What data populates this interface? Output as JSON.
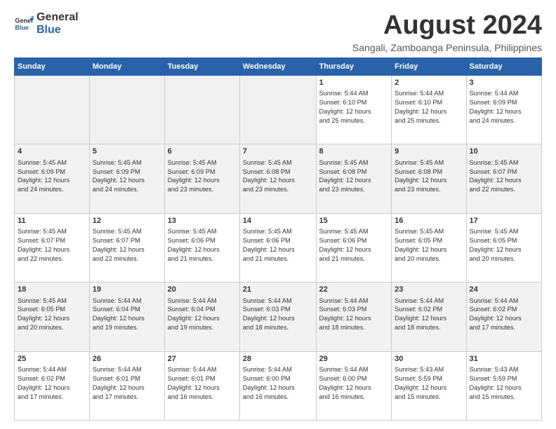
{
  "logo": {
    "line1": "General",
    "line2": "Blue"
  },
  "title": "August 2024",
  "subtitle": "Sangali, Zamboanga Peninsula, Philippines",
  "calendar": {
    "headers": [
      "Sunday",
      "Monday",
      "Tuesday",
      "Wednesday",
      "Thursday",
      "Friday",
      "Saturday"
    ],
    "weeks": [
      [
        {
          "day": "",
          "info": ""
        },
        {
          "day": "",
          "info": ""
        },
        {
          "day": "",
          "info": ""
        },
        {
          "day": "",
          "info": ""
        },
        {
          "day": "1",
          "info": "Sunrise: 5:44 AM\nSunset: 6:10 PM\nDaylight: 12 hours\nand 25 minutes."
        },
        {
          "day": "2",
          "info": "Sunrise: 5:44 AM\nSunset: 6:10 PM\nDaylight: 12 hours\nand 25 minutes."
        },
        {
          "day": "3",
          "info": "Sunrise: 5:44 AM\nSunset: 6:09 PM\nDaylight: 12 hours\nand 24 minutes."
        }
      ],
      [
        {
          "day": "4",
          "info": "Sunrise: 5:45 AM\nSunset: 6:09 PM\nDaylight: 12 hours\nand 24 minutes."
        },
        {
          "day": "5",
          "info": "Sunrise: 5:45 AM\nSunset: 6:09 PM\nDaylight: 12 hours\nand 24 minutes."
        },
        {
          "day": "6",
          "info": "Sunrise: 5:45 AM\nSunset: 6:09 PM\nDaylight: 12 hours\nand 23 minutes."
        },
        {
          "day": "7",
          "info": "Sunrise: 5:45 AM\nSunset: 6:08 PM\nDaylight: 12 hours\nand 23 minutes."
        },
        {
          "day": "8",
          "info": "Sunrise: 5:45 AM\nSunset: 6:08 PM\nDaylight: 12 hours\nand 23 minutes."
        },
        {
          "day": "9",
          "info": "Sunrise: 5:45 AM\nSunset: 6:08 PM\nDaylight: 12 hours\nand 23 minutes."
        },
        {
          "day": "10",
          "info": "Sunrise: 5:45 AM\nSunset: 6:07 PM\nDaylight: 12 hours\nand 22 minutes."
        }
      ],
      [
        {
          "day": "11",
          "info": "Sunrise: 5:45 AM\nSunset: 6:07 PM\nDaylight: 12 hours\nand 22 minutes."
        },
        {
          "day": "12",
          "info": "Sunrise: 5:45 AM\nSunset: 6:07 PM\nDaylight: 12 hours\nand 22 minutes."
        },
        {
          "day": "13",
          "info": "Sunrise: 5:45 AM\nSunset: 6:06 PM\nDaylight: 12 hours\nand 21 minutes."
        },
        {
          "day": "14",
          "info": "Sunrise: 5:45 AM\nSunset: 6:06 PM\nDaylight: 12 hours\nand 21 minutes."
        },
        {
          "day": "15",
          "info": "Sunrise: 5:45 AM\nSunset: 6:06 PM\nDaylight: 12 hours\nand 21 minutes."
        },
        {
          "day": "16",
          "info": "Sunrise: 5:45 AM\nSunset: 6:05 PM\nDaylight: 12 hours\nand 20 minutes."
        },
        {
          "day": "17",
          "info": "Sunrise: 5:45 AM\nSunset: 6:05 PM\nDaylight: 12 hours\nand 20 minutes."
        }
      ],
      [
        {
          "day": "18",
          "info": "Sunrise: 5:45 AM\nSunset: 6:05 PM\nDaylight: 12 hours\nand 20 minutes."
        },
        {
          "day": "19",
          "info": "Sunrise: 5:44 AM\nSunset: 6:04 PM\nDaylight: 12 hours\nand 19 minutes."
        },
        {
          "day": "20",
          "info": "Sunrise: 5:44 AM\nSunset: 6:04 PM\nDaylight: 12 hours\nand 19 minutes."
        },
        {
          "day": "21",
          "info": "Sunrise: 5:44 AM\nSunset: 6:03 PM\nDaylight: 12 hours\nand 18 minutes."
        },
        {
          "day": "22",
          "info": "Sunrise: 5:44 AM\nSunset: 6:03 PM\nDaylight: 12 hours\nand 18 minutes."
        },
        {
          "day": "23",
          "info": "Sunrise: 5:44 AM\nSunset: 6:02 PM\nDaylight: 12 hours\nand 18 minutes."
        },
        {
          "day": "24",
          "info": "Sunrise: 5:44 AM\nSunset: 6:02 PM\nDaylight: 12 hours\nand 17 minutes."
        }
      ],
      [
        {
          "day": "25",
          "info": "Sunrise: 5:44 AM\nSunset: 6:02 PM\nDaylight: 12 hours\nand 17 minutes."
        },
        {
          "day": "26",
          "info": "Sunrise: 5:44 AM\nSunset: 6:01 PM\nDaylight: 12 hours\nand 17 minutes."
        },
        {
          "day": "27",
          "info": "Sunrise: 5:44 AM\nSunset: 6:01 PM\nDaylight: 12 hours\nand 16 minutes."
        },
        {
          "day": "28",
          "info": "Sunrise: 5:44 AM\nSunset: 6:00 PM\nDaylight: 12 hours\nand 16 minutes."
        },
        {
          "day": "29",
          "info": "Sunrise: 5:44 AM\nSunset: 6:00 PM\nDaylight: 12 hours\nand 16 minutes."
        },
        {
          "day": "30",
          "info": "Sunrise: 5:43 AM\nSunset: 5:59 PM\nDaylight: 12 hours\nand 15 minutes."
        },
        {
          "day": "31",
          "info": "Sunrise: 5:43 AM\nSunset: 5:59 PM\nDaylight: 12 hours\nand 15 minutes."
        }
      ]
    ]
  }
}
